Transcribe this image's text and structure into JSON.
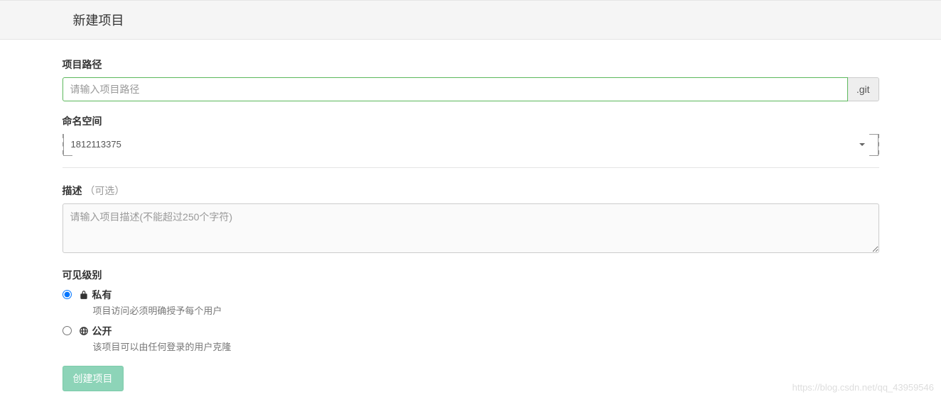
{
  "header": {
    "title": "新建项目"
  },
  "form": {
    "path": {
      "label": "项目路径",
      "placeholder": "请输入项目路径",
      "value": "",
      "suffix": ".git"
    },
    "namespace": {
      "label": "命名空间",
      "value": "1812113375"
    },
    "description": {
      "label": "描述",
      "optional": "（可选）",
      "placeholder": "请输入项目描述(不能超过250个字符)",
      "value": ""
    },
    "visibility": {
      "label": "可见级别",
      "options": [
        {
          "title": "私有",
          "desc": "项目访问必须明确授予每个用户",
          "checked": true,
          "icon": "lock-icon"
        },
        {
          "title": "公开",
          "desc": "该项目可以由任何登录的用户克隆",
          "checked": false,
          "icon": "globe-icon"
        }
      ]
    },
    "submit_label": "创建项目"
  },
  "watermark": "https://blog.csdn.net/qq_43959546"
}
